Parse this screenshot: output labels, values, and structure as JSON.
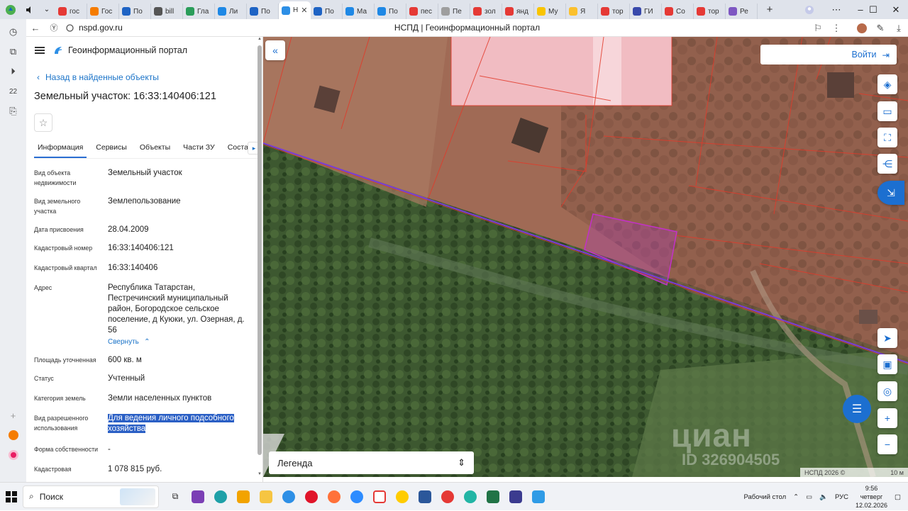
{
  "browser": {
    "tabs": [
      {
        "label": "гос",
        "color": "#e53935"
      },
      {
        "label": "Гос",
        "color": "#f57c00"
      },
      {
        "label": "По",
        "color": "#1e63c4"
      },
      {
        "label": "bill",
        "color": "#555555"
      },
      {
        "label": "Гла",
        "color": "#2a9d5a"
      },
      {
        "label": "Ли",
        "color": "#1e88e5"
      },
      {
        "label": "По",
        "color": "#1e63c4"
      },
      {
        "label": "Н",
        "color": "#2d8fe6",
        "active": true
      },
      {
        "label": "По",
        "color": "#1e63c4"
      },
      {
        "label": "Ма",
        "color": "#1e88e5"
      },
      {
        "label": "По",
        "color": "#1e88e5"
      },
      {
        "label": "пес",
        "color": "#e53935"
      },
      {
        "label": "Пе",
        "color": "#9e9e9e"
      },
      {
        "label": "зол",
        "color": "#e53935"
      },
      {
        "label": "янд",
        "color": "#e53935"
      },
      {
        "label": "Му",
        "color": "#f9c400"
      },
      {
        "label": "Я",
        "color": "#fbc02d"
      },
      {
        "label": "тор",
        "color": "#e53935"
      },
      {
        "label": "ГИ",
        "color": "#3949ab"
      },
      {
        "label": "Со",
        "color": "#e53935"
      },
      {
        "label": "тор",
        "color": "#e53935"
      },
      {
        "label": "Ре",
        "color": "#7e57c2"
      }
    ],
    "url": "nspd.gov.ru",
    "page_title": "НСПД | Геоинформационный портал"
  },
  "panel": {
    "app_title": "Геоинформационный портал",
    "back_label": "Назад в найденные объекты",
    "object_title": "Земельный участок: 16:33:140406:121",
    "tabs": [
      "Информация",
      "Сервисы",
      "Объекты",
      "Части ЗУ",
      "Соста"
    ],
    "fields": [
      {
        "label": "Вид объекта недвижимости",
        "value": "Земельный участок"
      },
      {
        "label": "Вид земельного участка",
        "value": "Землепользование"
      },
      {
        "label": "Дата присвоения",
        "value": "28.04.2009"
      },
      {
        "label": "Кадастровый номер",
        "value": "16:33:140406:121"
      },
      {
        "label": "Кадастровый квартал",
        "value": "16:33:140406"
      },
      {
        "label": "Адрес",
        "value": "Республика Татарстан, Пестречинский муниципальный район, Богородское сельское поселение, д Куюки, ул. Озерная, д. 56"
      },
      {
        "label": "Площадь уточненная",
        "value": "600 кв. м"
      },
      {
        "label": "Статус",
        "value": "Учтенный"
      },
      {
        "label": "Категория земель",
        "value": "Земли населенных пунктов"
      },
      {
        "label": "Вид разрешенного использования",
        "value": "Для ведения личного подсобного хозяйства"
      },
      {
        "label": "Форма собственности",
        "value": "-"
      },
      {
        "label": "Кадастровая",
        "value": "1 078 815 руб."
      }
    ],
    "collapse_label": "Свернуть"
  },
  "map": {
    "login_label": "Войти",
    "legend_label": "Легенда",
    "watermark": "циан",
    "watermark_id": "ID 326904505",
    "attribution": "НСПД 2026 ©",
    "scale_label": "10 м"
  },
  "taskbar": {
    "search_label": "Поиск",
    "desktop_label": "Рабочий стол",
    "lang": "РУС",
    "time": "9:56",
    "weekday": "четверг",
    "date": "12.02.2026"
  }
}
